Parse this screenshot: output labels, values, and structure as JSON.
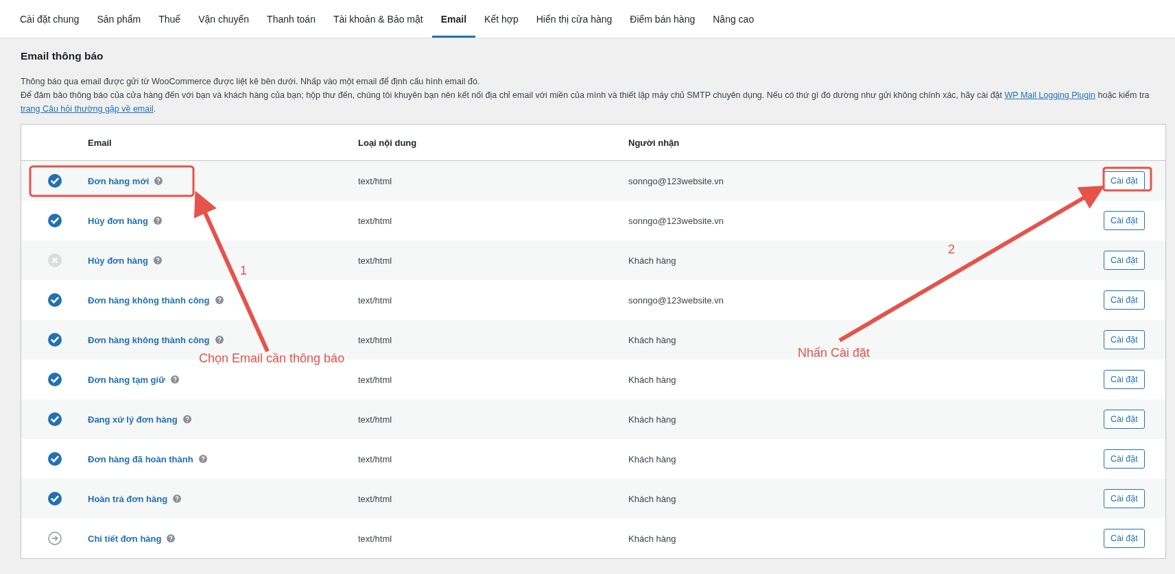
{
  "tabs": [
    {
      "label": "Cài đặt chung",
      "selected": false
    },
    {
      "label": "Sản phẩm",
      "selected": false
    },
    {
      "label": "Thuế",
      "selected": false
    },
    {
      "label": "Vận chuyển",
      "selected": false
    },
    {
      "label": "Thanh toán",
      "selected": false
    },
    {
      "label": "Tài khoản & Bảo mật",
      "selected": false
    },
    {
      "label": "Email",
      "selected": true
    },
    {
      "label": "Kết hợp",
      "selected": false
    },
    {
      "label": "Hiển thị cửa hàng",
      "selected": false
    },
    {
      "label": "Điểm bán hàng",
      "selected": false
    },
    {
      "label": "Nâng cao",
      "selected": false
    }
  ],
  "heading": "Email thông báo",
  "intro": "Thông báo qua email được gửi từ WooCommerce được liệt kê bên dưới. Nhấp vào một email để định cấu hình email đó.",
  "notice": {
    "text": "Để đảm bảo thông báo của cửa hàng đến với bạn và khách hàng của bạn; hộp thư đến, chúng tôi khuyên bạn nên kết nối địa chỉ email với miền của mình và thiết lập máy chủ SMTP chuyên dụng. Nếu có thứ gì đó dường như gửi không chính xác, hãy cài đặt",
    "link_1": "WP Mail Logging Plugin",
    "middle": "hoặc kiểm tra",
    "link_2": "trang Câu hỏi thường gặp về email",
    "end": "."
  },
  "table": {
    "columns": [
      "Email",
      "Loại nội dung",
      "Người nhận"
    ],
    "rows": [
      {
        "kind": "enabled",
        "name": "Đơn hàng mới",
        "content_type": "text/html",
        "recipient": "sonngo@123website.vn",
        "button": "Cài đặt"
      },
      {
        "kind": "enabled",
        "name": "Hủy đơn hàng",
        "content_type": "text/html",
        "recipient": "sonngo@123website.vn",
        "button": "Cài đặt"
      },
      {
        "kind": "disabled",
        "name": "Hủy đơn hàng",
        "content_type": "text/html",
        "recipient": "Khách hàng",
        "button": "Cài đặt"
      },
      {
        "kind": "enabled",
        "name": "Đơn hàng không thành công",
        "content_type": "text/html",
        "recipient": "sonngo@123website.vn",
        "button": "Cài đặt"
      },
      {
        "kind": "enabled",
        "name": "Đơn hàng không thành công",
        "content_type": "text/html",
        "recipient": "Khách hàng",
        "button": "Cài đặt"
      },
      {
        "kind": "enabled",
        "name": "Đơn hàng tạm giữ",
        "content_type": "text/html",
        "recipient": "Khách hàng",
        "button": "Cài đặt"
      },
      {
        "kind": "enabled",
        "name": "Đang xử lý đơn hàng",
        "content_type": "text/html",
        "recipient": "Khách hàng",
        "button": "Cài đặt"
      },
      {
        "kind": "enabled",
        "name": "Đơn hàng đã hoàn thành",
        "content_type": "text/html",
        "recipient": "Khách hàng",
        "button": "Cài đặt"
      },
      {
        "kind": "enabled",
        "name": "Hoàn trả đơn hàng",
        "content_type": "text/html",
        "recipient": "Khách hàng",
        "button": "Cài đặt"
      },
      {
        "kind": "manual",
        "name": "Chi tiết đơn hàng",
        "content_type": "text/html",
        "recipient": "Khách hàng",
        "button": "Cài đặt"
      }
    ]
  },
  "annotations": [
    {
      "number": "1",
      "caption": "Chọn Email cần thông báo"
    },
    {
      "number": "2",
      "caption": "Nhấn Cài đặt"
    }
  ]
}
